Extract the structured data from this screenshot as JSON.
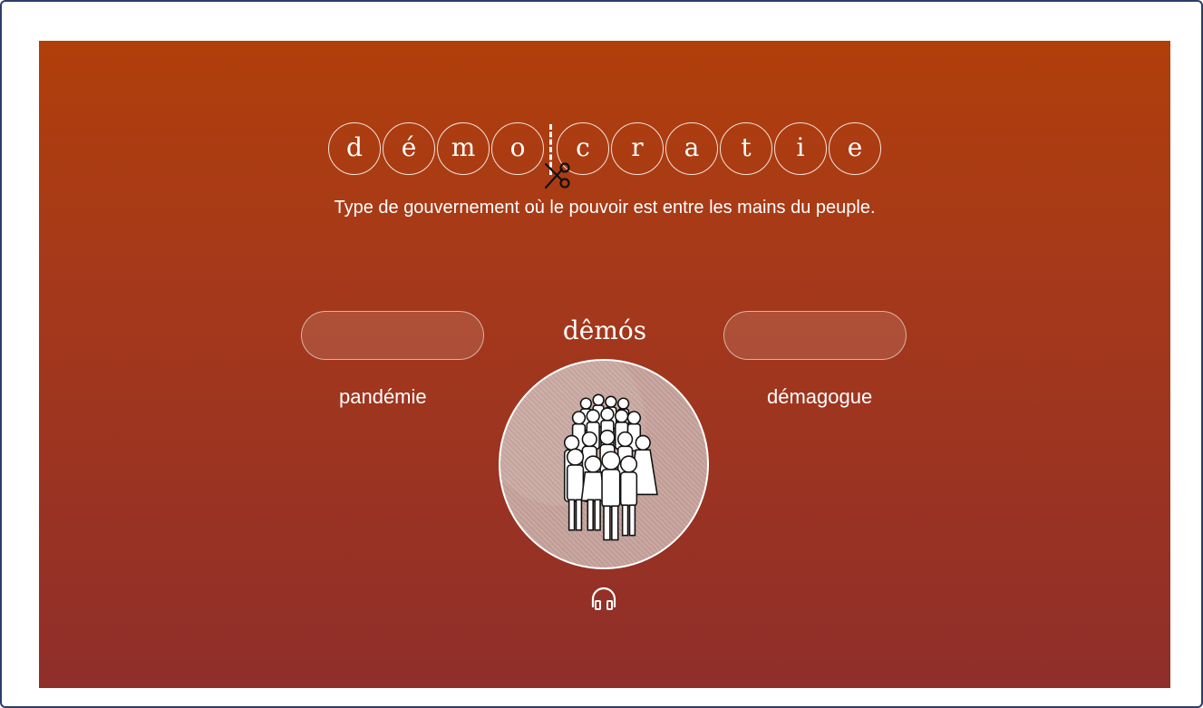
{
  "word": {
    "letters": [
      "d",
      "é",
      "m",
      "o",
      "c",
      "r",
      "a",
      "t",
      "i",
      "e"
    ],
    "definition": "Type de gouvernement où le pouvoir est entre les mains du peuple."
  },
  "root": {
    "title": "dêmós",
    "image_icon": "crowd-of-people-illustration"
  },
  "examples": {
    "left_word": "pandémie",
    "right_word": "démagogue"
  },
  "icons": {
    "scissors": "scissors-icon",
    "audio": "headphones-icon"
  },
  "colors": {
    "background_top": "#b03f0a",
    "background_bottom": "#8f2e2a",
    "frame_border": "#2f3d6c",
    "text": "#ffffff"
  }
}
